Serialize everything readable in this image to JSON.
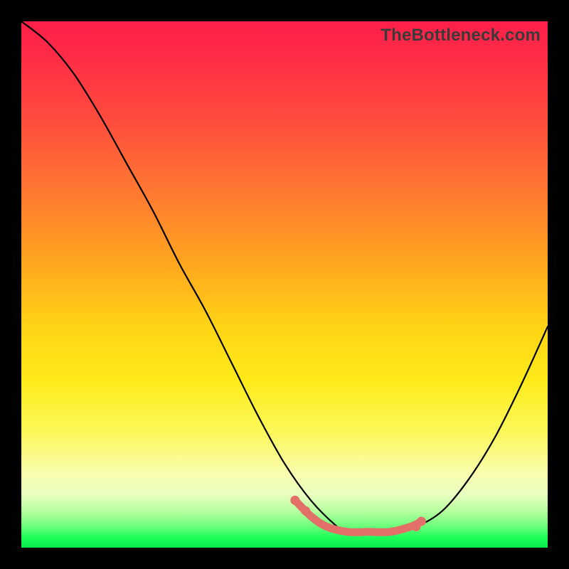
{
  "watermark": "TheBottleneck.com",
  "colors": {
    "frame": "#000000",
    "gradient_top": "#ff1f4a",
    "gradient_mid": "#ffd416",
    "gradient_bottom": "#07e84b",
    "curve": "#000000",
    "highlight": "#e26f68"
  },
  "chart_data": {
    "type": "line",
    "title": "",
    "xlabel": "",
    "ylabel": "",
    "xlim": [
      0,
      100
    ],
    "ylim": [
      0,
      100
    ],
    "grid": false,
    "note": "No axis ticks or numeric labels are visible; values are estimated from pixel positions on a 0–100 normalized scale, y=0 at bottom.",
    "series": [
      {
        "name": "bottleneck-curve",
        "x": [
          0,
          5,
          10,
          15,
          20,
          25,
          30,
          35,
          40,
          45,
          50,
          55,
          60,
          62,
          65,
          70,
          75,
          80,
          85,
          90,
          95,
          100
        ],
        "y": [
          100,
          96,
          90,
          82,
          73,
          64,
          54,
          45,
          35,
          25,
          16,
          9,
          4,
          3,
          3,
          3,
          4,
          7,
          13,
          21,
          31,
          42
        ]
      },
      {
        "name": "optimal-range-highlight",
        "x": [
          52,
          55,
          58,
          62,
          66,
          70,
          74,
          76
        ],
        "y": [
          9,
          6,
          4,
          3,
          3,
          3,
          4,
          5
        ]
      }
    ],
    "highlight_dots": {
      "name": "optimal-range-highlight",
      "x": [
        52,
        54,
        75,
        76
      ],
      "y": [
        9,
        7,
        4,
        5
      ]
    }
  }
}
